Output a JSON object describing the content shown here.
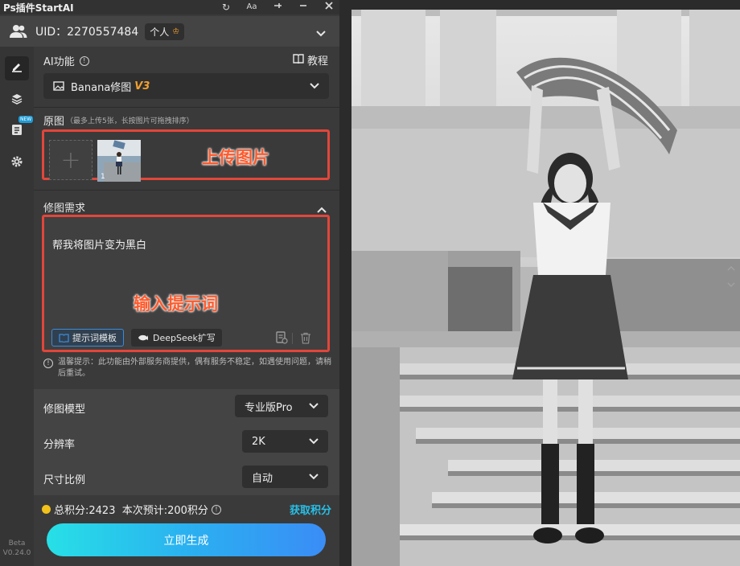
{
  "titlebar": {
    "title": "Ps插件StartAI",
    "controls": [
      {
        "name": "refresh-icon",
        "glyph": "↻"
      },
      {
        "name": "font-size-icon",
        "glyph": "Aa"
      },
      {
        "name": "pin-icon",
        "glyph": "⊸"
      },
      {
        "name": "minimize-icon",
        "glyph": "—"
      },
      {
        "name": "close-icon",
        "glyph": "✕"
      }
    ]
  },
  "user": {
    "uid_label": "UID：2270557484",
    "account_type": "个人",
    "account_badge_glyph": "♔"
  },
  "sidebar": {
    "items": [
      {
        "name": "edit-icon",
        "active": true
      },
      {
        "name": "layers-icon",
        "active": false
      },
      {
        "name": "notes-icon",
        "active": false,
        "badge": "NEW"
      },
      {
        "name": "gear-icon",
        "active": false
      }
    ],
    "beta_label": "Beta",
    "version": "V0.24.0"
  },
  "ai_function": {
    "label": "AI功能",
    "tutorial_label": "教程",
    "selected": "Banana修图",
    "selected_version": "V3"
  },
  "source_image": {
    "label": "原图",
    "hint": "（最多上传5张，长按图片可拖拽排序）",
    "add_glyph": "+",
    "thumb_index": "1",
    "annotation": "上传图片"
  },
  "prompt": {
    "label": "修图需求",
    "text": "帮我将图片变为黑白",
    "annotation": "输入提示词",
    "template_button": "提示词模板",
    "deepseek_button": "DeepSeek扩写"
  },
  "notice": {
    "text": "温馨提示：此功能由外部服务商提供，偶有服务不稳定，如遇使用问题，请稍后重试。"
  },
  "settings": {
    "model_label": "修图模型",
    "model_value": "专业版Pro",
    "resolution_label": "分辨率",
    "resolution_value": "2K",
    "ratio_label": "尺寸比例",
    "ratio_value": "自动"
  },
  "points": {
    "summary": "总积分:2423  本次预计:200积分",
    "get_label": "获取积分"
  },
  "generate_button": "立即生成",
  "colors": {
    "accent_red": "#e2463a",
    "annotation_orange": "#ff5a2c",
    "link_cyan": "#27c0e8",
    "version_gold": "#f0a030",
    "button_gradient_start": "#27e0e6",
    "button_gradient_end": "#3a8df6"
  }
}
